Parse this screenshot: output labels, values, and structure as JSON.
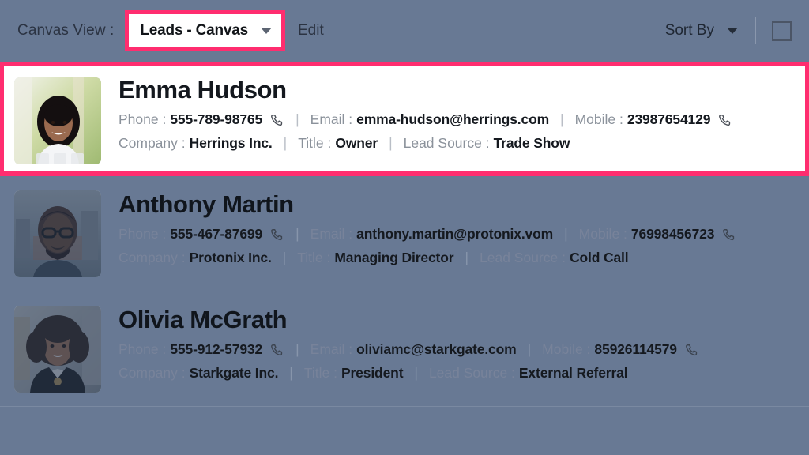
{
  "toolbar": {
    "canvas_view_label": "Canvas View :",
    "selected_view": "Leads - Canvas",
    "edit_label": "Edit",
    "sort_by_label": "Sort By",
    "caret_icon": "chevron-down-icon",
    "checkbox_icon": "checkbox-unchecked-icon",
    "highlight_color": "#FF2D6F"
  },
  "labels": {
    "phone": "Phone :",
    "email": "Email :",
    "mobile": "Mobile :",
    "company": "Company :",
    "title": "Title :",
    "lead_source": "Lead Source :",
    "separator": "|",
    "phone_icon": "phone-handset-icon"
  },
  "theme": {
    "background": "#687994",
    "card_selected_background": "#FFFFFF",
    "accent": "#FF2D6F"
  },
  "leads": [
    {
      "name": "Emma Hudson",
      "phone": "555-789-98765",
      "email": "emma-hudson@herrings.com",
      "mobile": "23987654129",
      "company": "Herrings Inc.",
      "title": "Owner",
      "lead_source": "Trade Show",
      "selected": true,
      "avatar": "woman-smiling-white-top-photo"
    },
    {
      "name": "Anthony Martin",
      "phone": "555-467-87699",
      "email": "anthony.martin@protonix.vom",
      "mobile": "76998456723",
      "company": "Protonix Inc.",
      "title": "Managing Director",
      "lead_source": "Cold Call",
      "selected": false,
      "avatar": "man-glasses-beard-photo"
    },
    {
      "name": "Olivia McGrath",
      "phone": "555-912-57932",
      "email": "oliviamc@starkgate.com",
      "mobile": "85926114579",
      "company": "Starkgate Inc.",
      "title": "President",
      "lead_source": "External Referral",
      "selected": false,
      "avatar": "woman-curly-hair-leather-jacket-photo"
    }
  ]
}
